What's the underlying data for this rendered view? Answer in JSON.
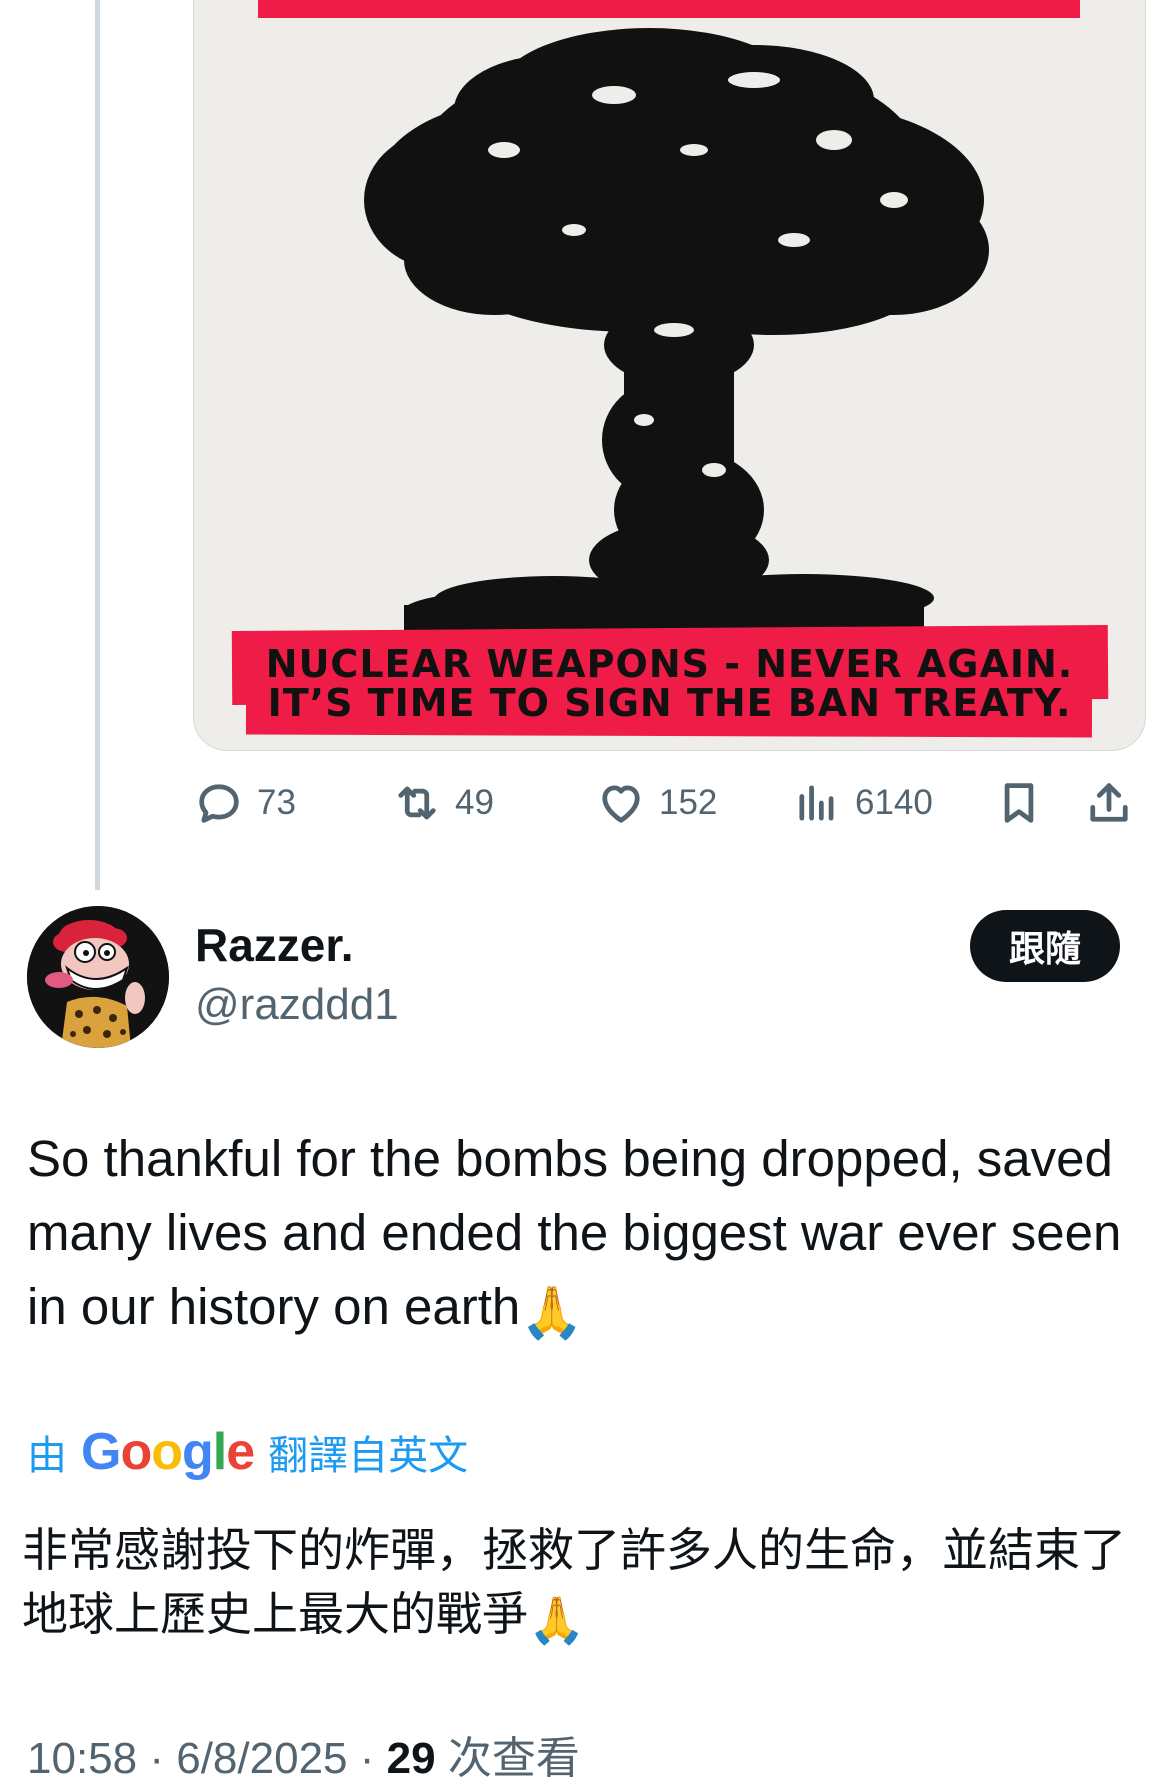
{
  "media": {
    "banner_line_1": "NUCLEAR WEAPONS - NEVER AGAIN.",
    "banner_line_2": "IT’S TIME TO SIGN THE BAN TREATY.",
    "colors": {
      "banner": "#ee1c46",
      "background": "#efede9",
      "cloud": "#111111"
    }
  },
  "actions": {
    "reply_count": "73",
    "retweet_count": "49",
    "like_count": "152",
    "views_count": "6140"
  },
  "reply": {
    "author_name": "Razzer.",
    "author_handle": "@razddd1",
    "follow_label": "跟隨",
    "text": "So thankful for the bombs being dropped, saved many lives and ended the biggest war ever seen in our history on earth",
    "emoji": "🙏",
    "translation": {
      "prefix": "由",
      "brand": "Google",
      "suffix": "翻譯自英文",
      "text": "非常感謝投下的炸彈，拯救了許多人的生命，並結束了地球上歷史上最大的戰爭"
    },
    "meta": {
      "time": "10:58",
      "separator": "·",
      "date": "6/8/2025",
      "views_count": "29",
      "views_label": "次查看"
    }
  },
  "colors": {
    "text_primary": "#0f1419",
    "text_secondary": "#536471",
    "link": "#1d9bf0",
    "follow_bg": "#0f1419"
  }
}
